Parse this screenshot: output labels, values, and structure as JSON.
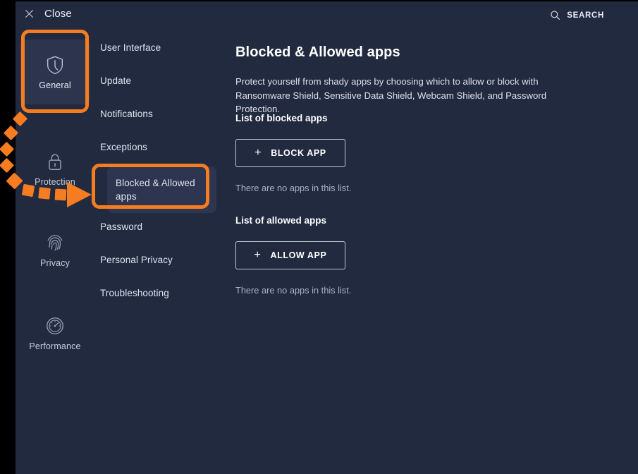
{
  "window": {
    "background_color": "#222a40",
    "accent_color": "#f57c20"
  },
  "topbar": {
    "close_label": "Close",
    "close_icon": "close-x-icon",
    "search_label": "SEARCH",
    "search_icon": "search-magnifier-icon"
  },
  "rail": {
    "items": [
      {
        "label": "General",
        "icon": "shield-icon",
        "active": true
      },
      {
        "label": "Protection",
        "icon": "lock-icon",
        "active": false
      },
      {
        "label": "Privacy",
        "icon": "fingerprint-icon",
        "active": false
      },
      {
        "label": "Performance",
        "icon": "speedometer-icon",
        "active": false
      }
    ]
  },
  "subnav": {
    "items": [
      {
        "label": "User Interface",
        "selected": false
      },
      {
        "label": "Update",
        "selected": false
      },
      {
        "label": "Notifications",
        "selected": false
      },
      {
        "label": "Exceptions",
        "selected": false
      },
      {
        "label": "Blocked & Allowed apps",
        "selected": true
      },
      {
        "label": "Password",
        "selected": false
      },
      {
        "label": "Personal Privacy",
        "selected": false
      },
      {
        "label": "Troubleshooting",
        "selected": false
      }
    ]
  },
  "main": {
    "title": "Blocked & Allowed apps",
    "description": "Protect yourself from shady apps by choosing which to allow or block with Ransomware Shield, Sensitive Data Shield, Webcam Shield, and Password Protection.",
    "blocked": {
      "section_title": "List of blocked apps",
      "button_label": "BLOCK APP",
      "button_plus": "+",
      "empty_text": "There are no apps in this list."
    },
    "allowed": {
      "section_title": "List of allowed apps",
      "button_label": "ALLOW APP",
      "button_plus": "+",
      "empty_text": "There are no apps in this list."
    }
  },
  "annotations": {
    "highlight_color": "#f57c20",
    "highlighted_items": [
      "General",
      "Blocked & Allowed apps"
    ],
    "arrow": "dashed-curved-arrow"
  }
}
